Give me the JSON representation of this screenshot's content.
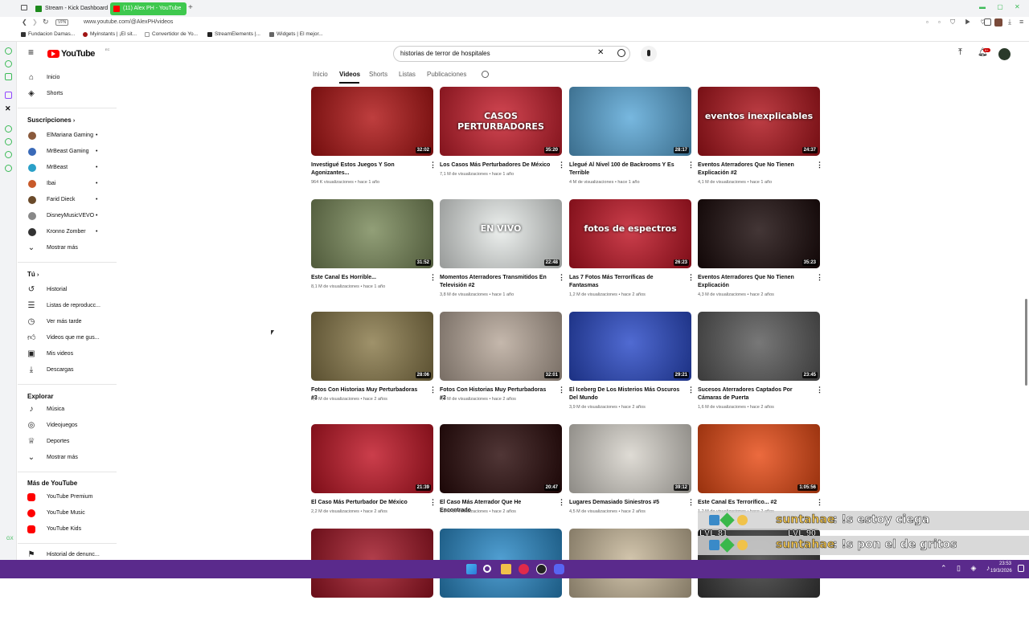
{
  "browser": {
    "tabs": [
      {
        "label": "Stream - Kick Dashboard"
      },
      {
        "label": "(11) Alex PH - YouTube"
      }
    ],
    "url": "www.youtube.com/@AlexPH/videos",
    "vpn": "VPN",
    "bookmarks": [
      "Fundacion Damas...",
      "Myinstants | ¡El sit...",
      "Convertidor de Yo...",
      "StreamElements |...",
      "Widgets | El mejor..."
    ]
  },
  "youtube": {
    "logo": "YouTube",
    "region": "EC",
    "search_value": "historias de terror de hospitales",
    "notif_count": "9+",
    "channel_tabs": [
      "Inicio",
      "Videos",
      "Shorts",
      "Listas",
      "Publicaciones"
    ],
    "active_tab": "Videos"
  },
  "sidebar": {
    "top": [
      {
        "label": "Inicio",
        "icon": "home-icon"
      },
      {
        "label": "Shorts",
        "icon": "shorts-icon"
      }
    ],
    "subs_title": "Suscripciones",
    "subs": [
      {
        "label": "ElMariana Gaming",
        "color": "#8a5a3c"
      },
      {
        "label": "MrBeast Gaming",
        "color": "#3a6ab8"
      },
      {
        "label": "MrBeast",
        "color": "#2aa0c8"
      },
      {
        "label": "Ibai",
        "color": "#c85a2a"
      },
      {
        "label": "Farid Dieck",
        "color": "#6a4a2a"
      },
      {
        "label": "DisneyMusicVEVO",
        "color": "#888888"
      },
      {
        "label": "Kronno Zomber",
        "color": "#333333"
      }
    ],
    "subs_more": "Mostrar más",
    "you_title": "Tú",
    "you": [
      {
        "label": "Historial",
        "icon": "history-icon"
      },
      {
        "label": "Listas de reproducc...",
        "icon": "playlist-icon"
      },
      {
        "label": "Ver más tarde",
        "icon": "clock-icon"
      },
      {
        "label": "Videos que me gus...",
        "icon": "like-icon"
      },
      {
        "label": "Mis videos",
        "icon": "my-videos-icon"
      },
      {
        "label": "Descargas",
        "icon": "download-icon"
      }
    ],
    "explore_title": "Explorar",
    "explore": [
      {
        "label": "Música",
        "icon": "music-icon"
      },
      {
        "label": "Videojuegos",
        "icon": "gaming-icon"
      },
      {
        "label": "Deportes",
        "icon": "trophy-icon"
      },
      {
        "label": "Mostrar más",
        "icon": "chevron-down-icon"
      }
    ],
    "more_title": "Más de YouTube",
    "more": [
      {
        "label": "YouTube Premium"
      },
      {
        "label": "YouTube Music"
      },
      {
        "label": "YouTube Kids"
      }
    ],
    "bottom": "Historial de denunc..."
  },
  "videos": [
    {
      "title": "Investigué Estos Juegos Y Son Agonizantes...",
      "views": "964 K visualizaciones",
      "ago": "hace 1 año",
      "duration": "32:02",
      "bg": "#b01414",
      "overlay": ""
    },
    {
      "title": "Los Casos Más Perturbadores De México",
      "views": "7,1 M de visualizaciones",
      "ago": "hace 1 año",
      "duration": "35:20",
      "bg": "#c81e2c",
      "overlay": "CASOS PERTURBADORES"
    },
    {
      "title": "Llegué Al Nivel 100 de Backrooms Y Es Terrible",
      "views": "4 M de visualizaciones",
      "ago": "hace 1 año",
      "duration": "28:17",
      "bg": "#5aa8d8",
      "overlay": ""
    },
    {
      "title": "Eventos Aterradores Que No Tienen Explicación #2",
      "views": "4,1 M de visualizaciones",
      "ago": "hace 1 año",
      "duration": "24:37",
      "bg": "#b0141c",
      "overlay": "eventos inexplicables"
    },
    {
      "title": "Este Canal Es Horrible...",
      "views": "8,1 M de visualizaciones",
      "ago": "hace 1 año",
      "duration": "31:52",
      "bg": "#7a8a5a",
      "overlay": ""
    },
    {
      "title": "Momentos Aterradores Transmitidos En Televisión #2",
      "views": "3,8 M de visualizaciones",
      "ago": "hace 1 año",
      "duration": "22:48",
      "bg": "#e8ecea",
      "overlay": "EN VIVO"
    },
    {
      "title": "Las 7 Fotos Más Terroríficas de Fantasmas",
      "views": "1,2 M de visualizaciones",
      "ago": "hace 2 años",
      "duration": "26:23",
      "bg": "#c01424",
      "overlay": "fotos de espectros"
    },
    {
      "title": "Eventos Aterradores Que No Tienen Explicación",
      "views": "4,3 M de visualizaciones",
      "ago": "hace 2 años",
      "duration": "35:23",
      "bg": "#1a0a0a",
      "overlay": ""
    },
    {
      "title": "Fotos Con Historias Muy Perturbadoras #3",
      "views": "2,9 M de visualizaciones",
      "ago": "hace 2 años",
      "duration": "28:06",
      "bg": "#8a7a4a",
      "overlay": ""
    },
    {
      "title": "Fotos Con Historias Muy Perturbadoras #2",
      "views": "2,9 M de visualizaciones",
      "ago": "hace 2 años",
      "duration": "32:01",
      "bg": "#b8a89a",
      "overlay": ""
    },
    {
      "title": "El Iceberg De Los Misterios Más Oscuros Del Mundo",
      "views": "3,9 M de visualizaciones",
      "ago": "hace 2 años",
      "duration": "29:21",
      "bg": "#2a4ac8",
      "overlay": ""
    },
    {
      "title": "Sucesos Aterradores Captados Por Cámaras de Puerta",
      "views": "1,6 M de visualizaciones",
      "ago": "hace 2 años",
      "duration": "23:45",
      "bg": "#5a5a5a",
      "overlay": ""
    },
    {
      "title": "El Caso Más Perturbador De México",
      "views": "2,2 M de visualizaciones",
      "ago": "hace 2 años",
      "duration": "21:39",
      "bg": "#c01424",
      "overlay": ""
    },
    {
      "title": "El Caso Más Aterrador Que He Encontrado",
      "views": "1,5 M de visualizaciones",
      "ago": "hace 2 años",
      "duration": "20:47",
      "bg": "#2a0a0a",
      "overlay": ""
    },
    {
      "title": "Lugares Demasiado Siniestros #5",
      "views": "4,5 M de visualizaciones",
      "ago": "hace 2 años",
      "duration": "39:12",
      "bg": "#d8d4cc",
      "overlay": ""
    },
    {
      "title": "Este Canal Es Terrorífico... #2",
      "views": "1,2 M de visualizaciones",
      "ago": "hace 2 años",
      "duration": "1:05:56",
      "bg": "#e84a14",
      "overlay": ""
    },
    {
      "title": "",
      "views": "",
      "ago": "",
      "duration": "",
      "bg": "#a01424",
      "overlay": ""
    },
    {
      "title": "",
      "views": "",
      "ago": "",
      "duration": "",
      "bg": "#2a8ac8",
      "overlay": ""
    },
    {
      "title": "",
      "views": "",
      "ago": "",
      "duration": "",
      "bg": "#c8b89a",
      "overlay": ""
    },
    {
      "title": "",
      "views": "",
      "ago": "",
      "duration": "",
      "bg": "#3a3a3a",
      "overlay": ""
    }
  ],
  "chat": [
    {
      "user": "suntahae",
      "message": ": !s estoy ciega",
      "level": "LVL 81"
    },
    {
      "user": "suntahae",
      "message": ": !s pon el de gritos",
      "level": "LVL 90"
    }
  ],
  "taskbar": {
    "time": "23:53",
    "date": "19/3/2026"
  }
}
